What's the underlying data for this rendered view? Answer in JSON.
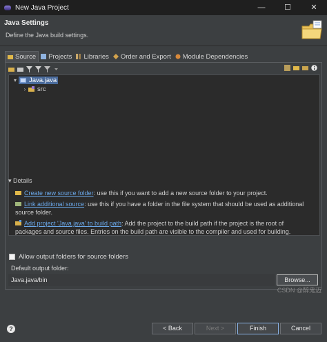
{
  "window": {
    "title": "New Java Project",
    "controls": [
      "—",
      "☐",
      "✕"
    ]
  },
  "header": {
    "title": "Java Settings",
    "subtitle": "Define the Java build settings."
  },
  "tabs": [
    {
      "label": "Source",
      "icon": "source-folder-icon",
      "active": true
    },
    {
      "label": "Projects",
      "icon": "projects-icon"
    },
    {
      "label": "Libraries",
      "icon": "libraries-icon"
    },
    {
      "label": "Order and Export",
      "icon": "order-export-icon"
    },
    {
      "label": "Module Dependencies",
      "icon": "module-dependencies-icon"
    }
  ],
  "tree": {
    "items": [
      {
        "label": "Java.java",
        "twisty": "▾",
        "icon": "java-project-icon",
        "selected": true
      },
      {
        "label": "src",
        "twisty": "›",
        "icon": "package-folder-icon"
      }
    ]
  },
  "details": {
    "label": "Details",
    "toggle": "▾",
    "items": [
      {
        "link": "Create new source folder",
        "text": ": use this if you want to add a new source folder to your project."
      },
      {
        "link": "Link additional source",
        "text": ": use this if you have a folder in the file system that should be used as additional source folder."
      },
      {
        "link": "Add project 'Java.java' to build path",
        "text": ": Add the project to the build path if the project is the root of packages and source files. Entries on the build path are visible to the compiler and used for building."
      }
    ]
  },
  "options": {
    "allow_output_label": "Allow output folders for source folders",
    "default_output_label": "Default output folder:",
    "default_output_value": "Java.java/bin",
    "browse_label": "Browse..."
  },
  "footer": {
    "help": "?",
    "back": "< Back",
    "next": "Next >",
    "finish": "Finish",
    "cancel": "Cancel"
  },
  "watermark": "CSDN @醉鬼迈",
  "colors": {
    "accent": "#4a6b9c",
    "link": "#6aa7e8",
    "background": "#3c3f41"
  }
}
